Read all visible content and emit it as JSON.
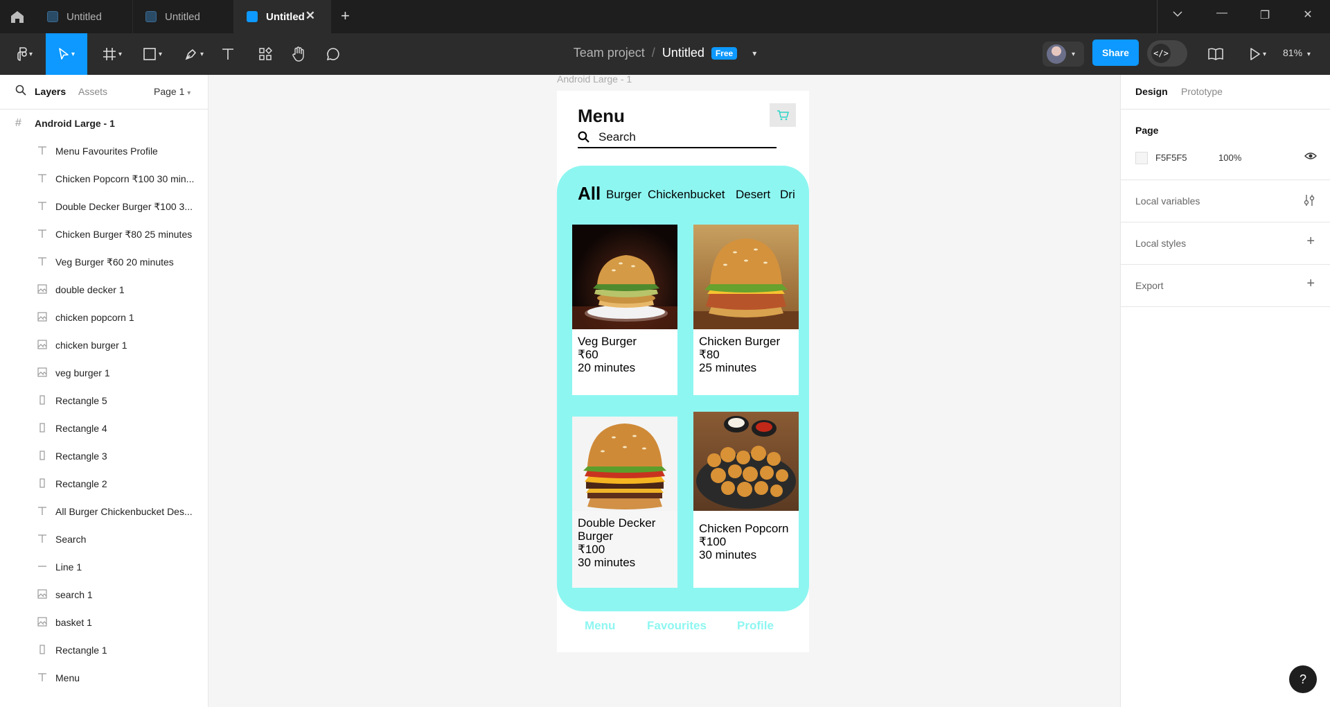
{
  "tabs": [
    {
      "label": "Untitled"
    },
    {
      "label": "Untitled"
    },
    {
      "label": "Untitled"
    }
  ],
  "breadcrumb": {
    "team": "Team project",
    "separator": "/",
    "file": "Untitled",
    "plan": "Free"
  },
  "toolbar": {
    "share": "Share",
    "zoom": "81%"
  },
  "left_panel": {
    "tabs": [
      "Layers",
      "Assets"
    ],
    "page_selector": "Page 1",
    "frame": "Android Large - 1",
    "layers": [
      {
        "icon": "text-icon",
        "label": "Menu Favourites Profile"
      },
      {
        "icon": "text-icon",
        "label": "Chicken Popcorn ₹100 30 min..."
      },
      {
        "icon": "text-icon",
        "label": "Double Decker Burger ₹100 3..."
      },
      {
        "icon": "text-icon",
        "label": "Chicken Burger ₹80 25 minutes"
      },
      {
        "icon": "text-icon",
        "label": "Veg Burger ₹60 20 minutes"
      },
      {
        "icon": "image-icon",
        "label": "double decker 1"
      },
      {
        "icon": "image-icon",
        "label": "chicken popcorn 1"
      },
      {
        "icon": "image-icon",
        "label": "chicken burger 1"
      },
      {
        "icon": "image-icon",
        "label": "veg burger 1"
      },
      {
        "icon": "rectangle-icon",
        "label": "Rectangle 5"
      },
      {
        "icon": "rectangle-icon",
        "label": "Rectangle 4"
      },
      {
        "icon": "rectangle-icon",
        "label": "Rectangle 3"
      },
      {
        "icon": "rectangle-icon",
        "label": "Rectangle 2"
      },
      {
        "icon": "text-icon",
        "label": "All Burger Chickenbucket Des..."
      },
      {
        "icon": "text-icon",
        "label": "Search"
      },
      {
        "icon": "line-icon",
        "label": "Line 1"
      },
      {
        "icon": "image-icon",
        "label": "search 1"
      },
      {
        "icon": "image-icon",
        "label": "basket 1"
      },
      {
        "icon": "rectangle-icon",
        "label": "Rectangle 1"
      },
      {
        "icon": "text-icon",
        "label": "Menu"
      }
    ]
  },
  "right_panel": {
    "tabs": [
      "Design",
      "Prototype"
    ],
    "page_heading": "Page",
    "page_color": "F5F5F5",
    "page_opacity": "100%",
    "sections": [
      "Local variables",
      "Local styles",
      "Export"
    ]
  },
  "canvas": {
    "frame_label": "Android Large - 1",
    "app": {
      "title": "Menu",
      "search_placeholder": "Search",
      "categories": [
        "All",
        "Burger",
        "Chickenbucket",
        "Desert",
        "Dri"
      ],
      "items": [
        {
          "name": "Veg Burger",
          "price": "₹60",
          "time": "20 minutes"
        },
        {
          "name": "Chicken Burger",
          "price": "₹80",
          "time": "25 minutes"
        },
        {
          "name": "Double Decker Burger",
          "price": "₹100",
          "time": "30 minutes"
        },
        {
          "name": "Chicken Popcorn",
          "price": "₹100",
          "time": "30 minutes"
        }
      ],
      "nav": [
        "Menu",
        "Favourites",
        "Profile"
      ]
    }
  },
  "colors": {
    "accent": "#0d99ff",
    "cyan": "#8ef6f1",
    "canvas": "#F5F5F5"
  }
}
